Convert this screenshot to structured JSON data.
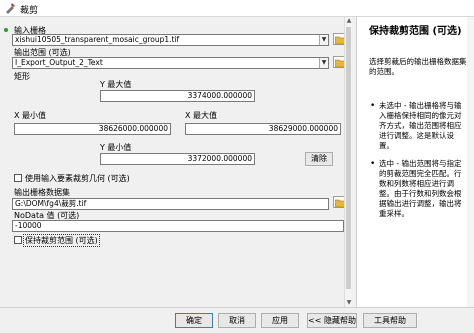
{
  "window": {
    "title": "裁剪"
  },
  "form": {
    "input_raster": {
      "label": "输入栅格",
      "value": "xishui10505_transparent_mosaic_group1.tif"
    },
    "output_extent": {
      "label": "输出范围 (可选)",
      "value": "I_Export_Output_2_Text"
    },
    "rectangle": {
      "label": "矩形",
      "y_max_label": "Y 最大值",
      "y_max": "3374000.000000",
      "x_min_label": "X 最小值",
      "x_min": "38626000.000000",
      "x_max_label": "X 最大值",
      "x_max": "38629000.000000",
      "y_min_label": "Y 最小值",
      "y_min": "3372000.000000",
      "clear_label": "清除"
    },
    "use_features_label": "使用输入要素裁剪几何 (可选)",
    "output_raster": {
      "label": "输出栅格数据集",
      "value": "G:\\DOM\\fg4\\裁剪.tif"
    },
    "nodata": {
      "label": "NoData 值 (可选)",
      "value": "-10000"
    },
    "maintain_extent_label": "保持裁剪范围 (可选)"
  },
  "help": {
    "title": "保持裁剪范围 (可选)",
    "description": "选择剪裁后的输出栅格数据集的范围。",
    "items": [
      "未选中 - 输出栅格将与输入栅格保持相同的像元对齐方式，输出范围将相应进行调整。这是默认设置。",
      "选中 - 输出范围将与指定的剪裁范围完全匹配。行数和列数将相应进行调整。由于行数和列数会根据输出进行调整，输出将重采样。"
    ]
  },
  "buttons": {
    "ok": "确定",
    "cancel": "取消",
    "apply": "应用",
    "hide_help": "<< 隐藏帮助",
    "tool_help": "工具帮助"
  }
}
